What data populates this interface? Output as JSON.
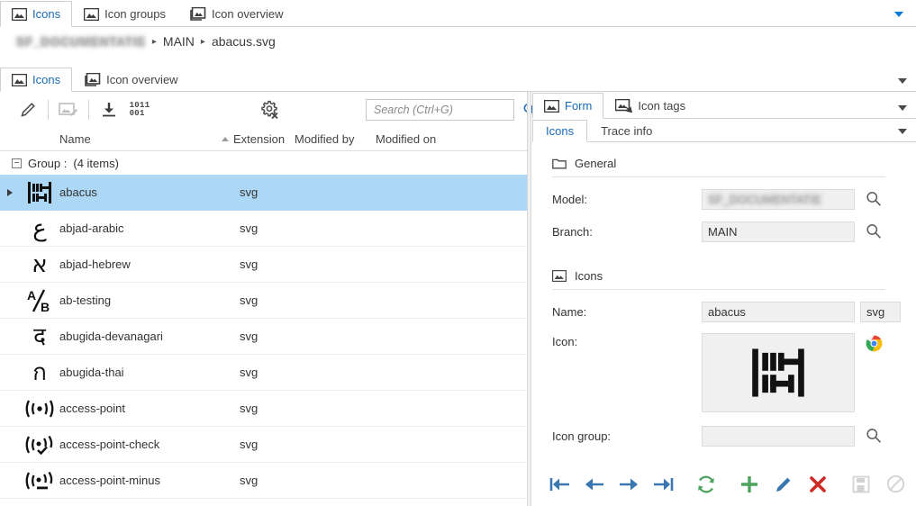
{
  "window": {
    "top_tabs": [
      {
        "label": "Icons",
        "icon": "image-icon",
        "active": true
      },
      {
        "label": "Icon groups",
        "icon": "image-icon",
        "active": false
      },
      {
        "label": "Icon overview",
        "icon": "images-stack-icon",
        "active": false
      }
    ],
    "overflow_caret": "chevron-down-icon"
  },
  "breadcrumb": {
    "items": [
      {
        "label": "SF_DOCUMENTATIE",
        "redacted": true
      },
      {
        "label": "MAIN",
        "redacted": false
      },
      {
        "label": "abacus.svg",
        "redacted": false
      }
    ],
    "separator": "▸"
  },
  "left_pane": {
    "sub_tabs": [
      {
        "label": "Icons",
        "icon": "image-icon",
        "active": true
      },
      {
        "label": "Icon overview",
        "icon": "images-stack-icon",
        "active": false
      }
    ],
    "toolbar": [
      {
        "name": "edit-pencil-button",
        "icon": "pencil-icon",
        "enabled": true
      },
      {
        "name": "edit-image-button",
        "icon": "image-edit-icon",
        "enabled": false
      },
      {
        "name": "download-button",
        "icon": "download-icon",
        "enabled": true
      },
      {
        "name": "binary-button",
        "icon": "binary-icon",
        "enabled": true,
        "text_top": "1011",
        "text_bottom": "001"
      },
      {
        "name": "clear-settings-button",
        "icon": "gear-x-icon",
        "enabled": true
      }
    ],
    "search": {
      "placeholder": "Search (Ctrl+G)",
      "value": "",
      "icon": "search-icon"
    },
    "columns": [
      {
        "label": "Name",
        "sorted": false
      },
      {
        "label": "Extension",
        "sorted": true,
        "sort_direction": "asc"
      },
      {
        "label": "Modified by",
        "sorted": false
      },
      {
        "label": "Modified on",
        "sorted": false
      }
    ],
    "group_row": {
      "expander": "−",
      "label": "Group :",
      "count": "(4 items)"
    },
    "rows": [
      {
        "name": "abacus",
        "extension": "svg",
        "glyph": "abacus",
        "selected": true,
        "has_expander": true
      },
      {
        "name": "abjad-arabic",
        "extension": "svg",
        "glyph": "ع",
        "selected": false,
        "has_expander": false
      },
      {
        "name": "abjad-hebrew",
        "extension": "svg",
        "glyph": "א",
        "selected": false,
        "has_expander": false
      },
      {
        "name": "ab-testing",
        "extension": "svg",
        "glyph": "ab",
        "selected": false,
        "has_expander": false
      },
      {
        "name": "abugida-devanagari",
        "extension": "svg",
        "glyph": "द",
        "selected": false,
        "has_expander": false
      },
      {
        "name": "abugida-thai",
        "extension": "svg",
        "glyph": "ก",
        "selected": false,
        "has_expander": false
      },
      {
        "name": "access-point",
        "extension": "svg",
        "glyph": "ap",
        "selected": false,
        "has_expander": false
      },
      {
        "name": "access-point-check",
        "extension": "svg",
        "glyph": "apc",
        "selected": false,
        "has_expander": false
      },
      {
        "name": "access-point-minus",
        "extension": "svg",
        "glyph": "apm",
        "selected": false,
        "has_expander": false
      }
    ]
  },
  "right_pane": {
    "tabs": [
      {
        "label": "Form",
        "icon": "image-icon",
        "active": true
      },
      {
        "label": "Icon tags",
        "icon": "image-tag-icon",
        "active": false
      }
    ],
    "sub_tabs": [
      {
        "label": "Icons",
        "active": true
      },
      {
        "label": "Trace info",
        "active": false
      }
    ],
    "overflow_caret": "chevron-down-icon",
    "sections": [
      {
        "title": "General",
        "icon": "folder-icon",
        "fields": [
          {
            "label": "Model:",
            "value": "SF_DOCUMENTATIE",
            "redacted": true,
            "lookup_icon": "search-icon"
          },
          {
            "label": "Branch:",
            "value": "MAIN",
            "redacted": false,
            "lookup_icon": "search-icon"
          }
        ]
      },
      {
        "title": "Icons",
        "icon": "image-icon",
        "fields": [
          {
            "label": "Name:",
            "value": "abacus",
            "extension_value": "svg",
            "redacted": false
          },
          {
            "label": "Icon:",
            "value": "",
            "preview_glyph": "abacus",
            "badge_icon": "chrome-icon"
          },
          {
            "label": "Icon group:",
            "value": "",
            "redacted": false,
            "lookup_icon": "search-icon"
          }
        ]
      }
    ],
    "actions": [
      {
        "name": "first-record-button",
        "icon": "arrow-first-icon",
        "color": "#3a76b0",
        "enabled": true
      },
      {
        "name": "previous-record-button",
        "icon": "arrow-left-icon",
        "color": "#3a76b0",
        "enabled": true
      },
      {
        "name": "next-record-button",
        "icon": "arrow-right-icon",
        "color": "#3a76b0",
        "enabled": true
      },
      {
        "name": "last-record-button",
        "icon": "arrow-last-icon",
        "color": "#3a76b0",
        "enabled": true
      },
      {
        "name": "refresh-button",
        "icon": "refresh-icon",
        "color": "#4da45f",
        "enabled": true
      },
      {
        "name": "add-button",
        "icon": "plus-icon",
        "color": "#4da45f",
        "enabled": true
      },
      {
        "name": "edit-button",
        "icon": "pencil-icon",
        "color": "#3a76b0",
        "enabled": true
      },
      {
        "name": "delete-button",
        "icon": "cross-icon",
        "color": "#cc2a24",
        "enabled": true
      },
      {
        "name": "save-button",
        "icon": "save-icon",
        "color": "#d3d3d3",
        "enabled": false
      },
      {
        "name": "cancel-button",
        "icon": "cancel-icon",
        "color": "#d3d3d3",
        "enabled": false
      }
    ]
  },
  "colors": {
    "accent": "#1a6bb5",
    "selection": "#ACD7F5",
    "blue": "#3a76b0",
    "green": "#4da45f",
    "red": "#cc2a24",
    "disabled": "#d3d3d3",
    "caret": "#0a7ad6"
  }
}
